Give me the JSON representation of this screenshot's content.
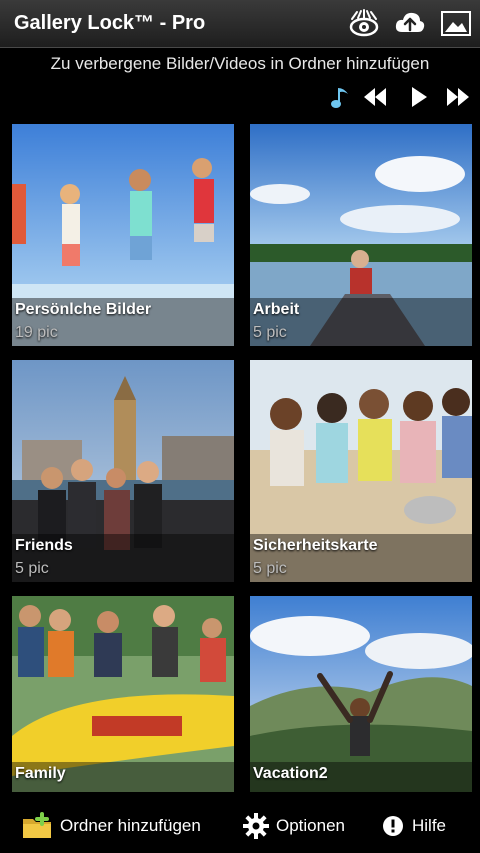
{
  "header": {
    "title": "Gallery Lock™ - Pro",
    "icons": [
      "eye-icon",
      "cloud-upload-icon",
      "image-icon"
    ]
  },
  "hint": "Zu verbergene Bilder/Videos in Ordner hinzufügen",
  "player": {
    "icons": [
      "music-note-icon",
      "rewind-icon",
      "play-icon",
      "fast-forward-icon"
    ],
    "accent": "#6ec6f0"
  },
  "folders": [
    {
      "name": "Persönlche Bilder",
      "count": "19 pic"
    },
    {
      "name": "Arbeit",
      "count": "5 pic"
    },
    {
      "name": "Friends",
      "count": "5 pic"
    },
    {
      "name": "Sicherheitskarte",
      "count": "5 pic"
    },
    {
      "name": "Family",
      "count": ""
    },
    {
      "name": "Vacation2",
      "count": ""
    }
  ],
  "bottom_bar": {
    "add_folder": "Ordner hinzufügen",
    "options": "Optionen",
    "help": "Hilfe"
  }
}
